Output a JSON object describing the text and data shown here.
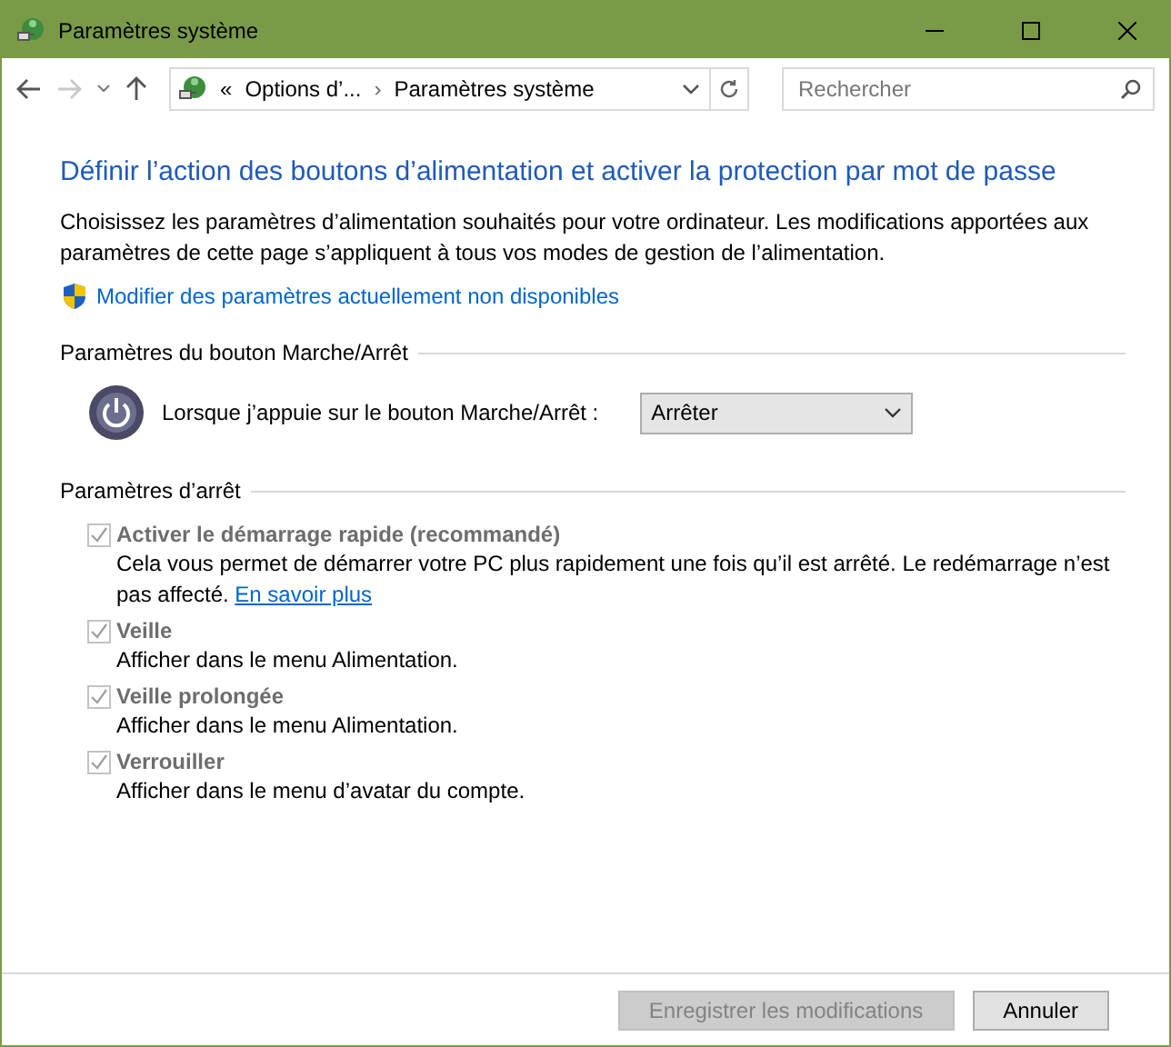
{
  "window": {
    "title": "Paramètres système"
  },
  "nav": {
    "back_disabled": false,
    "forward_disabled": true,
    "breadcrumb_prefix": "«",
    "breadcrumb": [
      {
        "label": "Options d’..."
      },
      {
        "label": "Paramètres système"
      }
    ],
    "separator": "›",
    "search": {
      "placeholder": "Rechercher"
    }
  },
  "heading": "Définir l’action des boutons d’alimentation et activer la protection par mot de passe",
  "intro": "Choisissez les paramètres d’alimentation souhaités pour votre ordinateur. Les modifications apportées aux paramètres de cette page s’appliquent à tous vos modes de gestion de l’alimentation.",
  "admin_link": "Modifier des paramètres actuellement non disponibles",
  "power_section": {
    "title": "Paramètres du bouton Marche/Arrêt",
    "label": "Lorsque j’appuie sur le bouton Marche/Arrêt :",
    "value": "Arrêter"
  },
  "shutdown_section": {
    "title": "Paramètres d’arrêt",
    "options": [
      {
        "label": "Activer le démarrage rapide (recommandé)",
        "checked": true,
        "disabled": true,
        "description": "Cela vous permet de démarrer votre PC plus rapidement une fois qu’il est arrêté. Le redémarrage n’est pas affecté.",
        "link": "En savoir plus"
      },
      {
        "label": "Veille",
        "checked": true,
        "disabled": true,
        "description": "Afficher dans le menu Alimentation."
      },
      {
        "label": "Veille prolongée",
        "checked": true,
        "disabled": true,
        "description": "Afficher dans le menu Alimentation."
      },
      {
        "label": "Verrouiller",
        "checked": true,
        "disabled": true,
        "description": "Afficher dans le menu d’avatar du compte."
      }
    ]
  },
  "buttons": [
    {
      "label": "Enregistrer les modifications",
      "disabled": true
    },
    {
      "label": "Annuler",
      "disabled": false
    }
  ]
}
